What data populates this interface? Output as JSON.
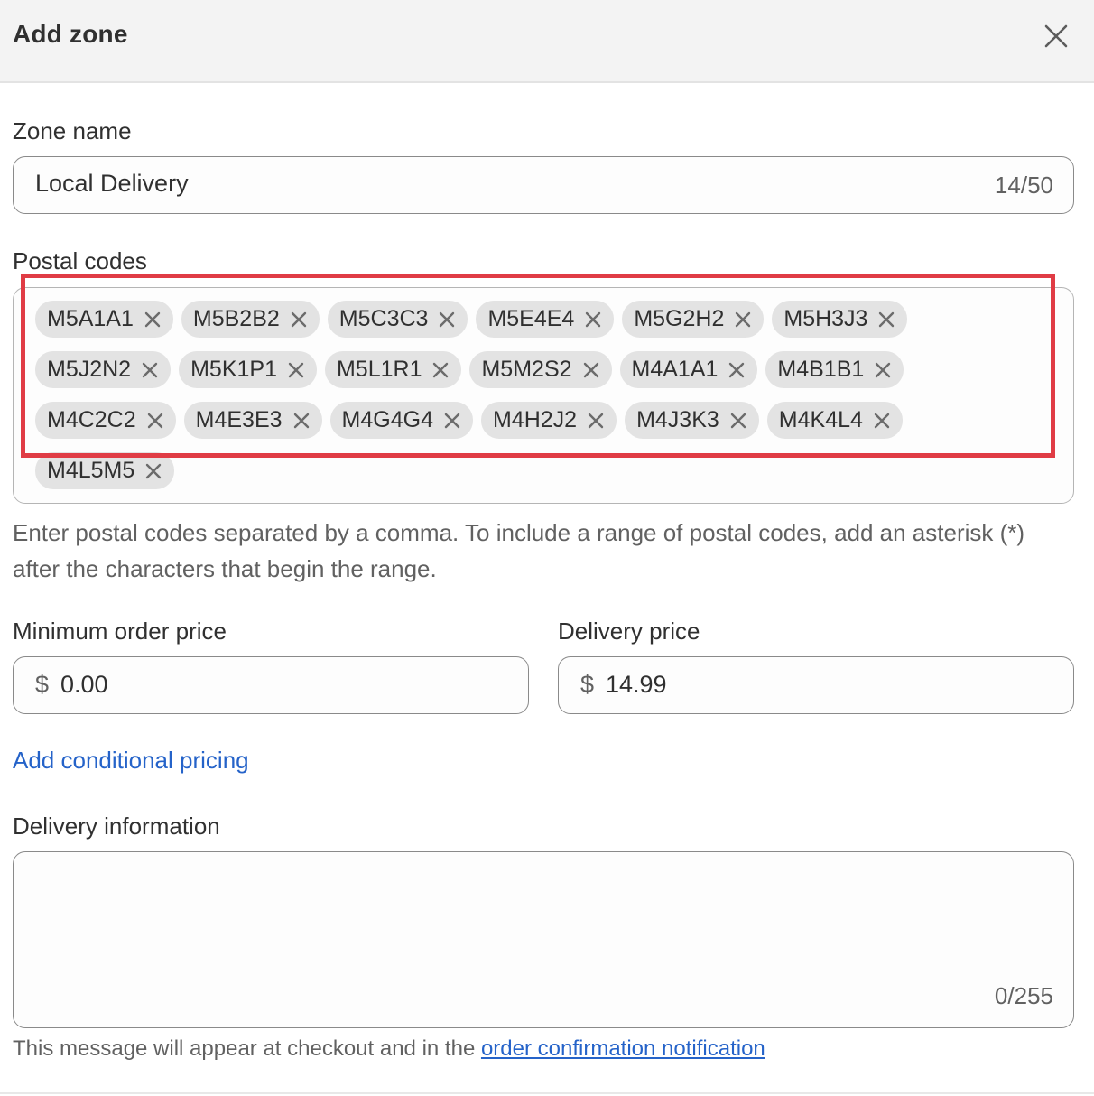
{
  "header": {
    "title": "Add zone",
    "close_icon": "close-icon"
  },
  "zone_name": {
    "label": "Zone name",
    "value": "Local Delivery",
    "counter": "14/50"
  },
  "postal_codes": {
    "label": "Postal codes",
    "tags": [
      "M5A1A1",
      "M5B2B2",
      "M5C3C3",
      "M5E4E4",
      "M5G2H2",
      "M5H3J3",
      "M5J2N2",
      "M5K1P1",
      "M5L1R1",
      "M5M2S2",
      "M4A1A1",
      "M4B1B1",
      "M4C2C2",
      "M4E3E3",
      "M4G4G4",
      "M4H2J2",
      "M4J3K3",
      "M4K4L4",
      "M4L5M5"
    ],
    "help": "Enter postal codes separated by a comma. To include a range of postal codes, add an asterisk (*) after the characters that begin the range.",
    "highlight_color": "#e03c45"
  },
  "minimum_order": {
    "label": "Minimum order price",
    "currency": "$",
    "value": "0.00"
  },
  "delivery_price": {
    "label": "Delivery price",
    "currency": "$",
    "value": "14.99"
  },
  "conditional_pricing": {
    "label": "Add conditional pricing"
  },
  "delivery_information": {
    "label": "Delivery information",
    "value": "",
    "counter": "0/255",
    "note_prefix": "This message will appear at checkout and in the ",
    "note_link": "order confirmation notification"
  },
  "colors": {
    "link": "#2563c9",
    "tag_bg": "#e3e3e3",
    "header_bg": "#f3f3f3"
  }
}
